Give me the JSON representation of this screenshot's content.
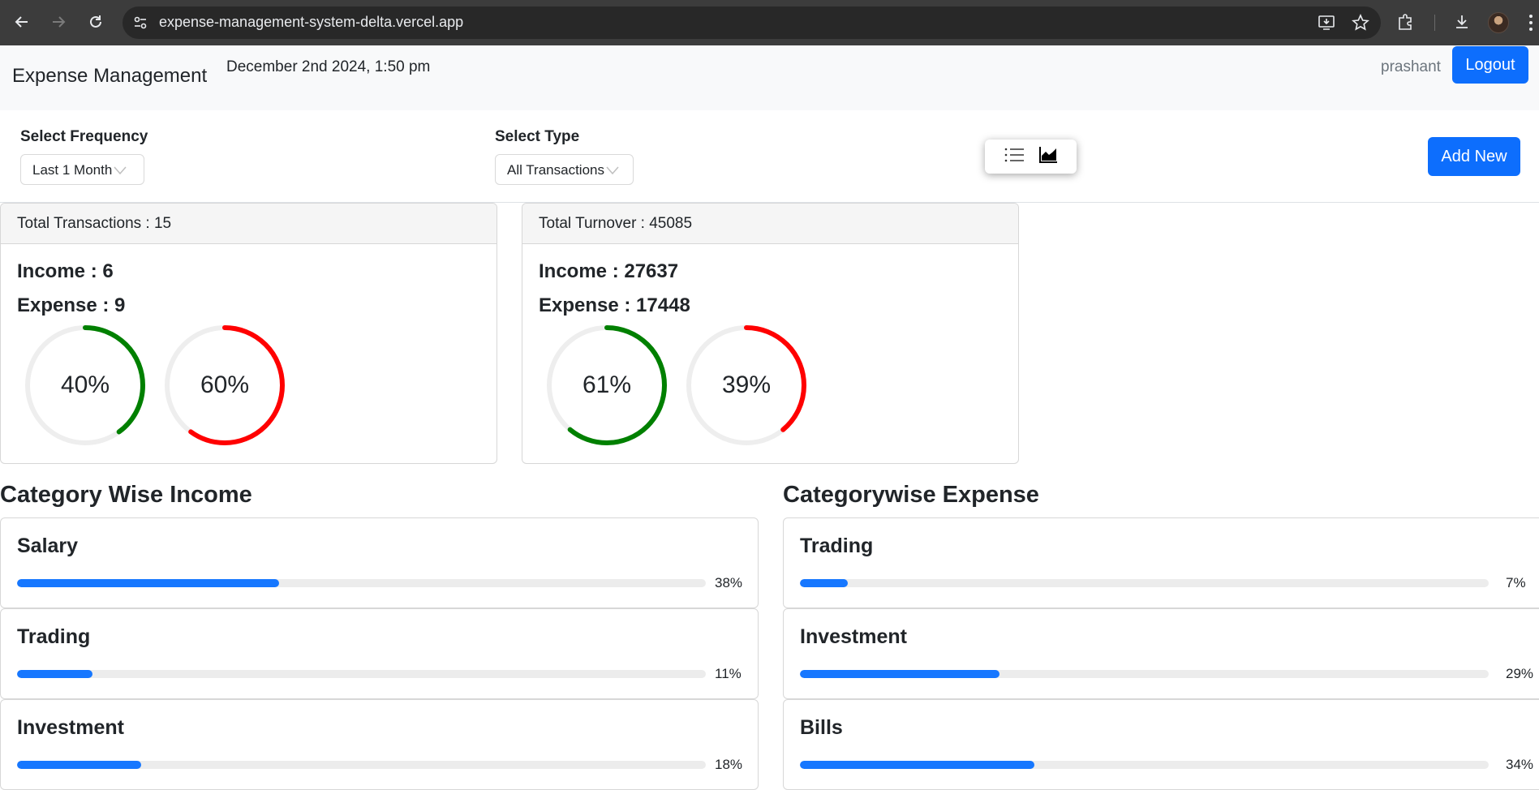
{
  "browser": {
    "url": "expense-management-system-delta.vercel.app"
  },
  "header": {
    "brand": "Expense Management",
    "datetime": "December 2nd 2024, 1:50 pm",
    "username": "prashant",
    "logout_label": "Logout"
  },
  "filters": {
    "frequency_label": "Select Frequency",
    "frequency_value": "Last 1 Month",
    "type_label": "Select Type",
    "type_value": "All Transactions",
    "add_new_label": "Add New"
  },
  "transactions_card": {
    "header": "Total Transactions : 15",
    "income": "Income : 6",
    "expense": "Expense : 9",
    "income_pct": 40,
    "expense_pct": 60,
    "income_pct_label": "40%",
    "expense_pct_label": "60%"
  },
  "turnover_card": {
    "header": "Total Turnover : 45085",
    "income": "Income : 27637",
    "expense": "Expense : 17448",
    "income_pct": 61,
    "expense_pct": 39,
    "income_pct_label": "61%",
    "expense_pct_label": "39%"
  },
  "colors": {
    "income": "#008000",
    "expense": "#ff0000",
    "primary": "#0d6efd",
    "progress": "#1677ff"
  },
  "category_income": {
    "title": "Category Wise Income",
    "items": [
      {
        "name": "Salary",
        "percent": 38,
        "label": "38%"
      },
      {
        "name": "Trading",
        "percent": 11,
        "label": "11%"
      },
      {
        "name": "Investment",
        "percent": 18,
        "label": "18%"
      }
    ]
  },
  "category_expense": {
    "title": "Categorywise Expense",
    "items": [
      {
        "name": "Trading",
        "percent": 7,
        "label": "7%"
      },
      {
        "name": "Investment",
        "percent": 29,
        "label": "29%"
      },
      {
        "name": "Bills",
        "percent": 34,
        "label": "34%"
      }
    ]
  }
}
